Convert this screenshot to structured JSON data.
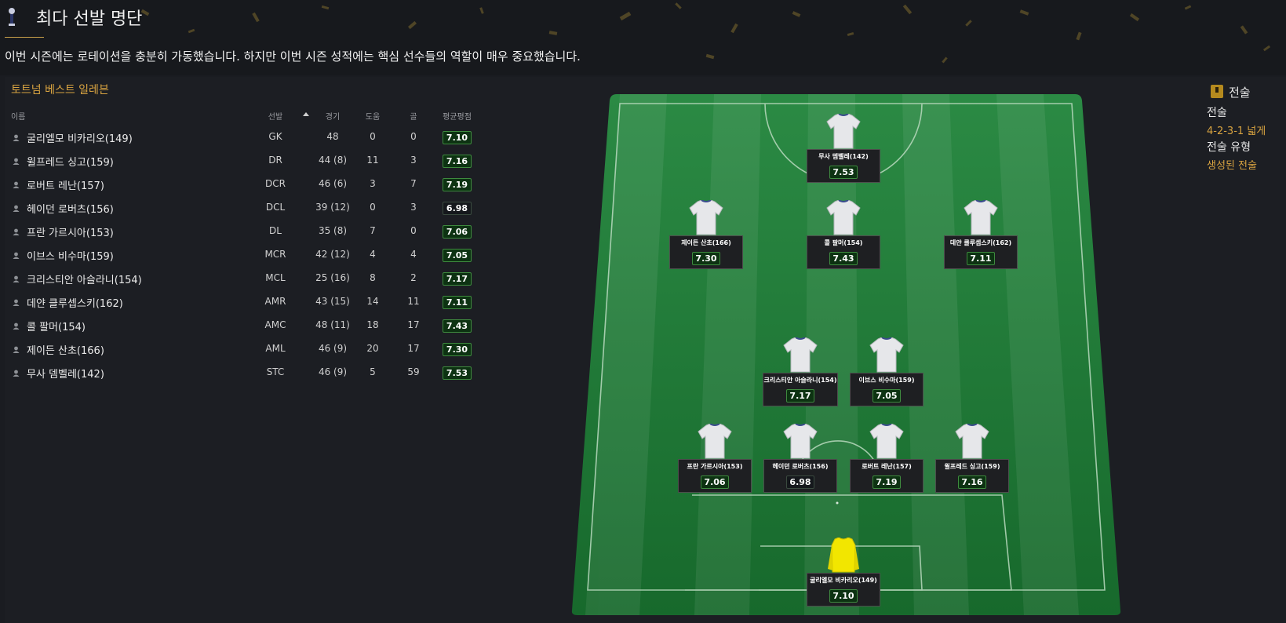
{
  "page": {
    "title": "최다 선발 명단",
    "subtitle": "이번 시즌에는 로테이션을 충분히 가동했습니다. 하지만 이번 시즌 성적에는 핵심 선수들의 역할이 매우 중요했습니다."
  },
  "squad": {
    "title": "토트넘 베스트 일레븐",
    "columns": {
      "name": "이름",
      "position": "선발",
      "apps": "경기",
      "assists": "도움",
      "goals": "골",
      "rating": "평균평점"
    },
    "rows": [
      {
        "name": "굴리엘모 비카리오(149)",
        "position": "GK",
        "apps": "48",
        "assists": "0",
        "goals": "0",
        "rating": "7.10"
      },
      {
        "name": "윌프레드 싱고(159)",
        "position": "DR",
        "apps": "44 (8)",
        "assists": "11",
        "goals": "3",
        "rating": "7.16"
      },
      {
        "name": "로버트 레난(157)",
        "position": "DCR",
        "apps": "46 (6)",
        "assists": "3",
        "goals": "7",
        "rating": "7.19"
      },
      {
        "name": "헤이던 로버츠(156)",
        "position": "DCL",
        "apps": "39 (12)",
        "assists": "0",
        "goals": "3",
        "rating": "6.98"
      },
      {
        "name": "프란 가르시아(153)",
        "position": "DL",
        "apps": "35 (8)",
        "assists": "7",
        "goals": "0",
        "rating": "7.06"
      },
      {
        "name": "이브스 비수마(159)",
        "position": "MCR",
        "apps": "42 (12)",
        "assists": "4",
        "goals": "4",
        "rating": "7.05"
      },
      {
        "name": "크리스티안 아슬라니(154)",
        "position": "MCL",
        "apps": "25 (16)",
        "assists": "8",
        "goals": "2",
        "rating": "7.17"
      },
      {
        "name": "데얀 클루셉스키(162)",
        "position": "AMR",
        "apps": "43 (15)",
        "assists": "14",
        "goals": "11",
        "rating": "7.11"
      },
      {
        "name": "콜 팔머(154)",
        "position": "AMC",
        "apps": "48 (11)",
        "assists": "18",
        "goals": "17",
        "rating": "7.43"
      },
      {
        "name": "제이든 산초(166)",
        "position": "AML",
        "apps": "46 (9)",
        "assists": "20",
        "goals": "17",
        "rating": "7.30"
      },
      {
        "name": "무사 뎀벨레(142)",
        "position": "STC",
        "apps": "46 (9)",
        "assists": "5",
        "goals": "59",
        "rating": "7.53"
      }
    ]
  },
  "pitch": {
    "players": [
      {
        "name": "무사 뎀벨레(142)",
        "rating": "7.53"
      },
      {
        "name": "제이든 산초(166)",
        "rating": "7.30"
      },
      {
        "name": "콜 팔머(154)",
        "rating": "7.43"
      },
      {
        "name": "데얀 클루셉스키(162)",
        "rating": "7.11"
      },
      {
        "name": "크리스티안 아슬라니(154)",
        "rating": "7.17"
      },
      {
        "name": "이브스 비수마(159)",
        "rating": "7.05"
      },
      {
        "name": "프란 가르시아(153)",
        "rating": "7.06"
      },
      {
        "name": "헤이던 로버츠(156)",
        "rating": "6.98"
      },
      {
        "name": "로버트 레난(157)",
        "rating": "7.19"
      },
      {
        "name": "윌프레드 싱고(159)",
        "rating": "7.16"
      },
      {
        "name": "굴리엘모 비카리오(149)",
        "rating": "7.10"
      }
    ]
  },
  "tactics": {
    "heading": "전술",
    "formation_label": "전술",
    "formation_value": "4-2-3-1 넓게",
    "type_label": "전술 유형",
    "type_value": "생성된 전술"
  },
  "colors": {
    "accent_gold": "#d9a441",
    "rating_green": "#0d3212",
    "pitch_green": "#1f7a35",
    "keeper_shirt": "#f2e600"
  },
  "icons": [
    "club-crest-icon",
    "person-icon",
    "sort-asc-icon",
    "tactics-icon",
    "shirt-icon"
  ]
}
